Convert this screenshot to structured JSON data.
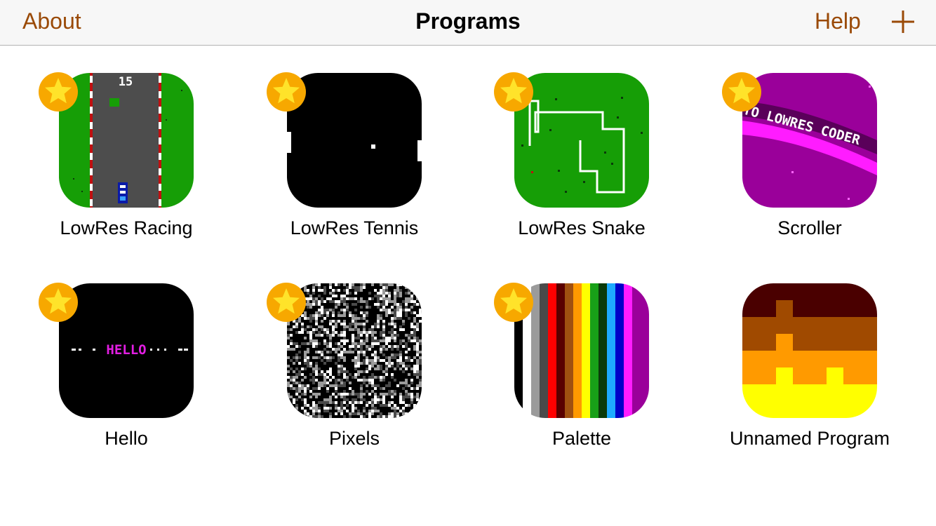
{
  "nav": {
    "about_label": "About",
    "title": "Programs",
    "help_label": "Help",
    "add_icon": "plus-icon"
  },
  "programs": [
    {
      "name": "LowRes Racing",
      "favorite": true,
      "thumb": "racing"
    },
    {
      "name": "LowRes Tennis",
      "favorite": true,
      "thumb": "tennis"
    },
    {
      "name": "LowRes Snake",
      "favorite": true,
      "thumb": "snake"
    },
    {
      "name": "Scroller",
      "favorite": true,
      "thumb": "scroller"
    },
    {
      "name": "Hello",
      "favorite": true,
      "thumb": "hello"
    },
    {
      "name": "Pixels",
      "favorite": true,
      "thumb": "pixels"
    },
    {
      "name": "Palette",
      "favorite": true,
      "thumb": "palette"
    },
    {
      "name": "Unnamed Program",
      "favorite": false,
      "thumb": "unnamed"
    }
  ],
  "thumb_text": {
    "racing_score": "15",
    "hello_text": "HELLO",
    "scroller_text": "TO LOWRES CODER"
  },
  "colors": {
    "accent": "#9a4a07",
    "star": "#f7a800"
  }
}
